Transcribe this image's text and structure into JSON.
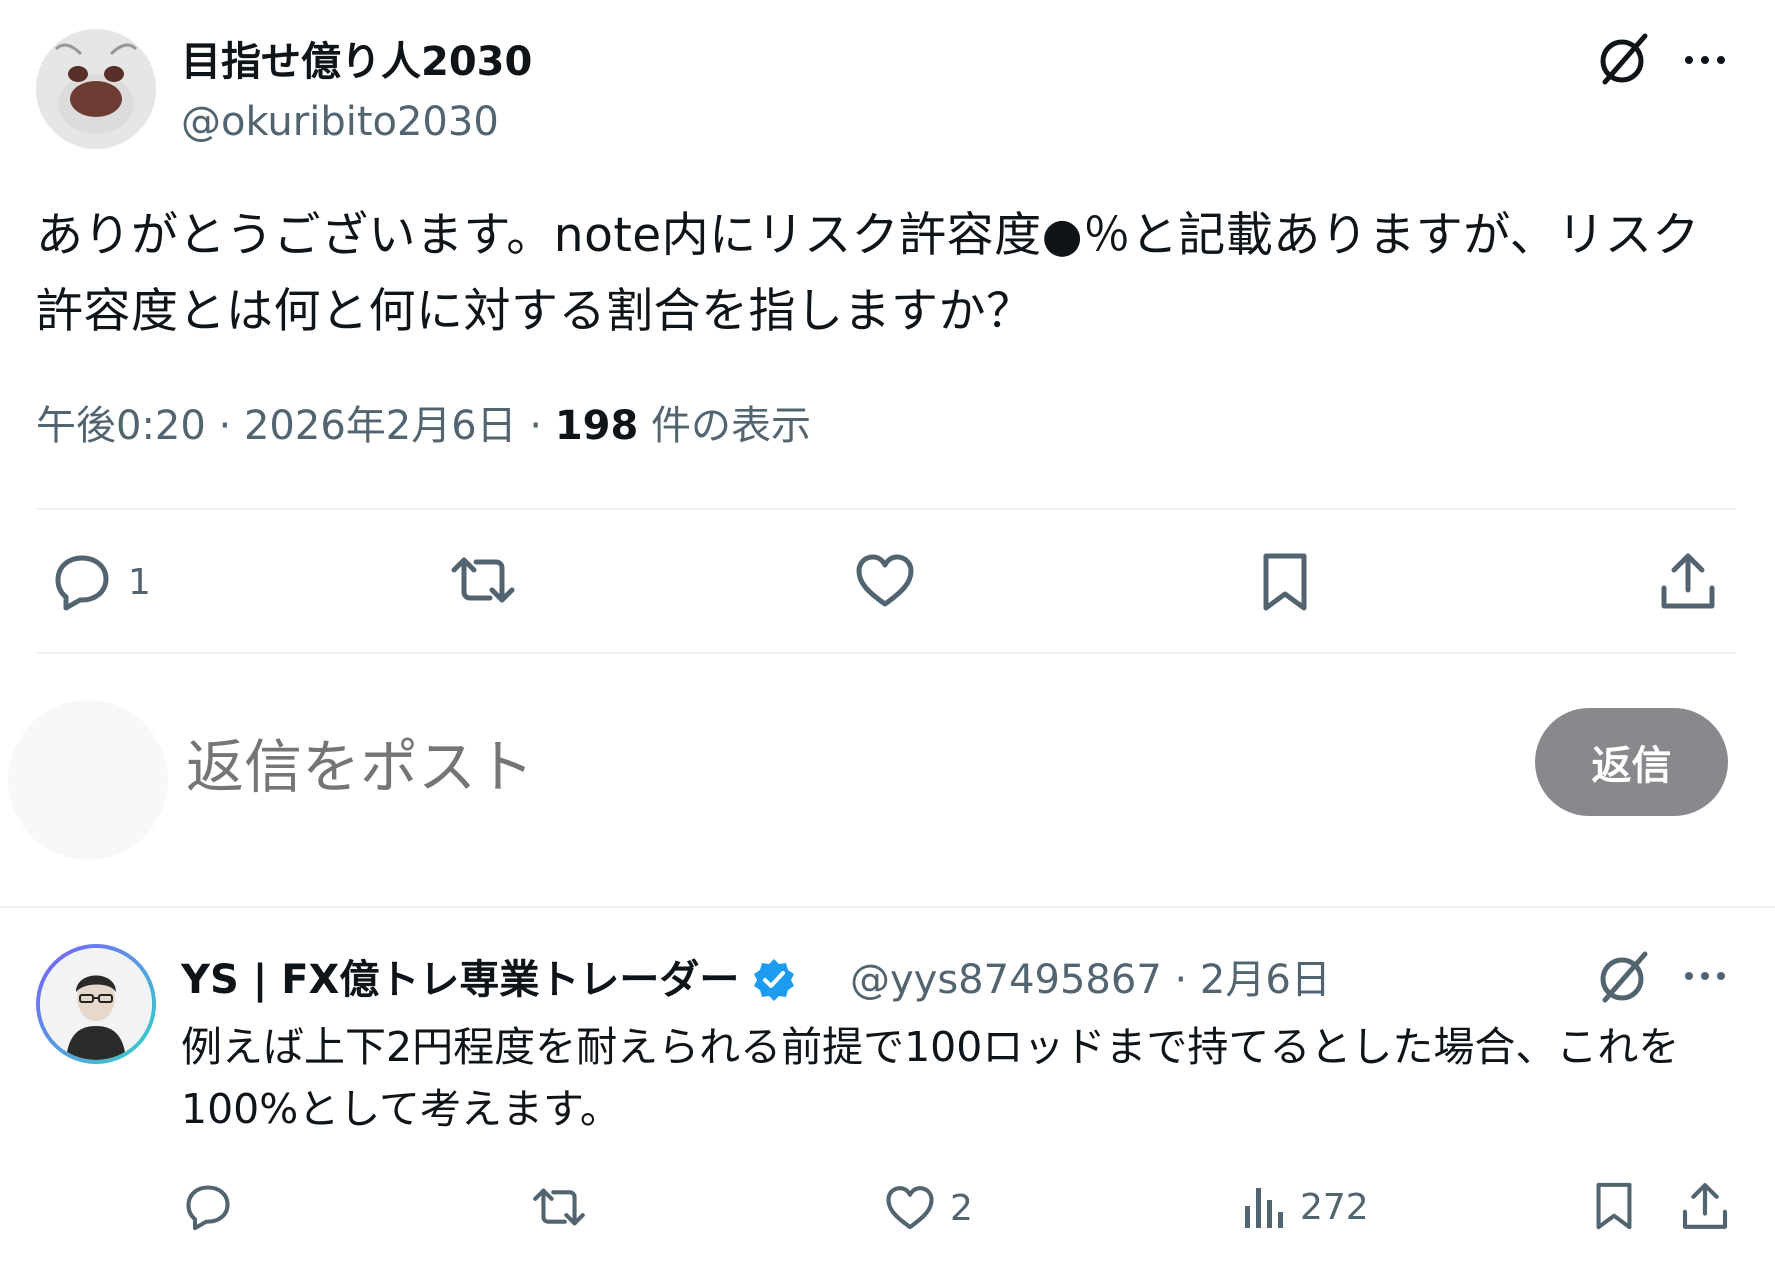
{
  "tweet": {
    "author_name": "目指せ億り人2030",
    "handle": "@okuribito2030",
    "text": "ありがとうございます。note内にリスク許容度●％と記載ありますが、リスク許容度とは何と何に対する割合を指しますか？",
    "time": "午後0:20 · 2026年2月6日 · ",
    "views_count": "198",
    "views_label": " 件の表示",
    "actions": {
      "reply_count": "1"
    }
  },
  "composer": {
    "placeholder": "返信をポスト",
    "button_label": "返信"
  },
  "reply": {
    "author_name": "YS | FX億トレ専業トレーダー",
    "handle_date": "@yys87495867 · 2月6日",
    "text": "例えば上下2円程度を耐えられる前提で100ロッドまで持てるとした場合、これを100%として考えます。",
    "actions": {
      "like_count": "2",
      "views_count": "272"
    }
  },
  "colors": {
    "text": "#0f1419",
    "muted": "#536471",
    "divider": "#eff3f4",
    "verified": "#1d9bf0",
    "reply_button": "#87898c"
  },
  "icons": [
    "grok-icon",
    "more-icon",
    "reply-icon",
    "retweet-icon",
    "like-icon",
    "bookmark-icon",
    "share-icon",
    "views-icon",
    "verified-badge-icon"
  ]
}
